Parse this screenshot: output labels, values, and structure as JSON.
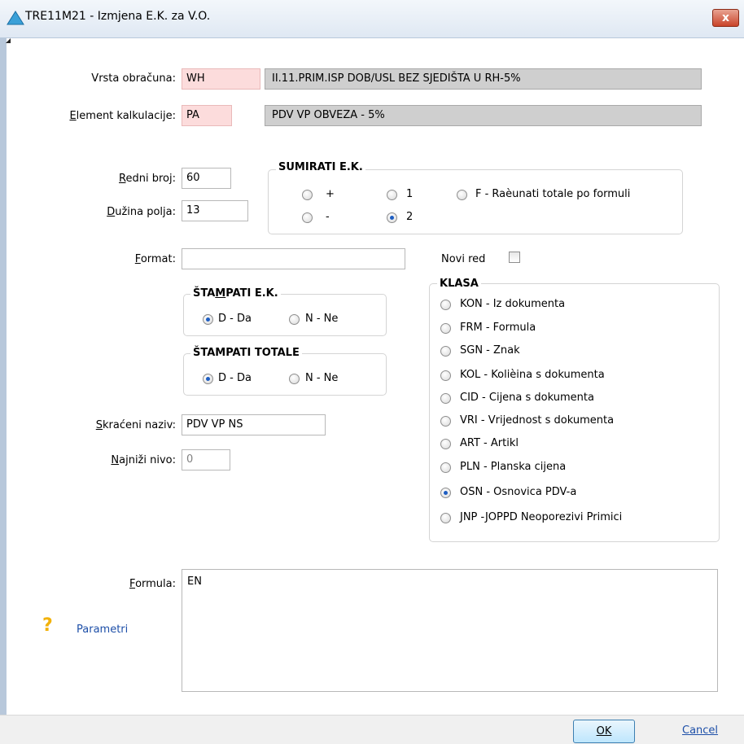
{
  "window": {
    "title": "TRE11M21 - Izmjena E.K. za V.O.",
    "close_label": "x"
  },
  "vrsta_obracuna": {
    "label": "Vrsta obračuna:",
    "code": "WH",
    "description": "II.11.PRIM.ISP DOB/USL BEZ SJEDIŠTA U RH-5%"
  },
  "element_kalkulacije": {
    "label": "Element kalkulacije:",
    "code": "PA",
    "description": "PDV VP OBVEZA - 5%"
  },
  "redni_broj": {
    "label": "Redni broj:",
    "value": "60"
  },
  "duzina_polja": {
    "label": "Dužina polja:",
    "value": "13"
  },
  "sumirati": {
    "title": "SUMIRATI E.K.",
    "options": [
      {
        "label": "+",
        "checked": false
      },
      {
        "label": "-",
        "checked": false
      },
      {
        "label": "1",
        "checked": false
      },
      {
        "label": "2",
        "checked": true
      },
      {
        "label": "F - Raèunati totale po formuli",
        "checked": false
      }
    ]
  },
  "format": {
    "label": "Format:",
    "value": ""
  },
  "novi_red": {
    "label": "Novi red",
    "checked": false
  },
  "stampati_ek": {
    "title": "ŠTAMPATI E.K.",
    "options": [
      {
        "label": "D - Da",
        "checked": true
      },
      {
        "label": "N - Ne",
        "checked": false
      }
    ]
  },
  "stampati_totale": {
    "title": "ŠTAMPATI TOTALE",
    "options": [
      {
        "label": "D - Da",
        "checked": true
      },
      {
        "label": "N - Ne",
        "checked": false
      }
    ]
  },
  "klasa": {
    "title": "KLASA",
    "options": [
      {
        "label": "KON - Iz dokumenta",
        "checked": false
      },
      {
        "label": "FRM - Formula",
        "checked": false
      },
      {
        "label": "SGN - Znak",
        "checked": false
      },
      {
        "label": "KOL - Kolièina s dokumenta",
        "checked": false
      },
      {
        "label": "CID - Cijena s dokumenta",
        "checked": false
      },
      {
        "label": "VRI - Vrijednost s dokumenta",
        "checked": false
      },
      {
        "label": "ART - Artikl",
        "checked": false
      },
      {
        "label": "PLN - Planska cijena",
        "checked": false
      },
      {
        "label": "OSN - Osnovica PDV-a",
        "checked": true
      },
      {
        "label": "JNP -JOPPD Neoporezivi Primici",
        "checked": false
      }
    ]
  },
  "skraceni_naziv": {
    "label": "Skraćeni naziv:",
    "value": "PDV VP NS"
  },
  "najnizi_nivo": {
    "label": "Najniži nivo:",
    "value": "0"
  },
  "formula": {
    "label": "Formula:",
    "value": "EN"
  },
  "parametri": {
    "label": "Parametri",
    "icon": "question-mark-icon"
  },
  "buttons": {
    "ok": "OK",
    "cancel": "Cancel"
  },
  "colors": {
    "code_bg": "#fcdcdc",
    "desc_bg": "#cfcfcf",
    "link": "#1d4fa8",
    "radio_dot": "#1e5ec2"
  }
}
